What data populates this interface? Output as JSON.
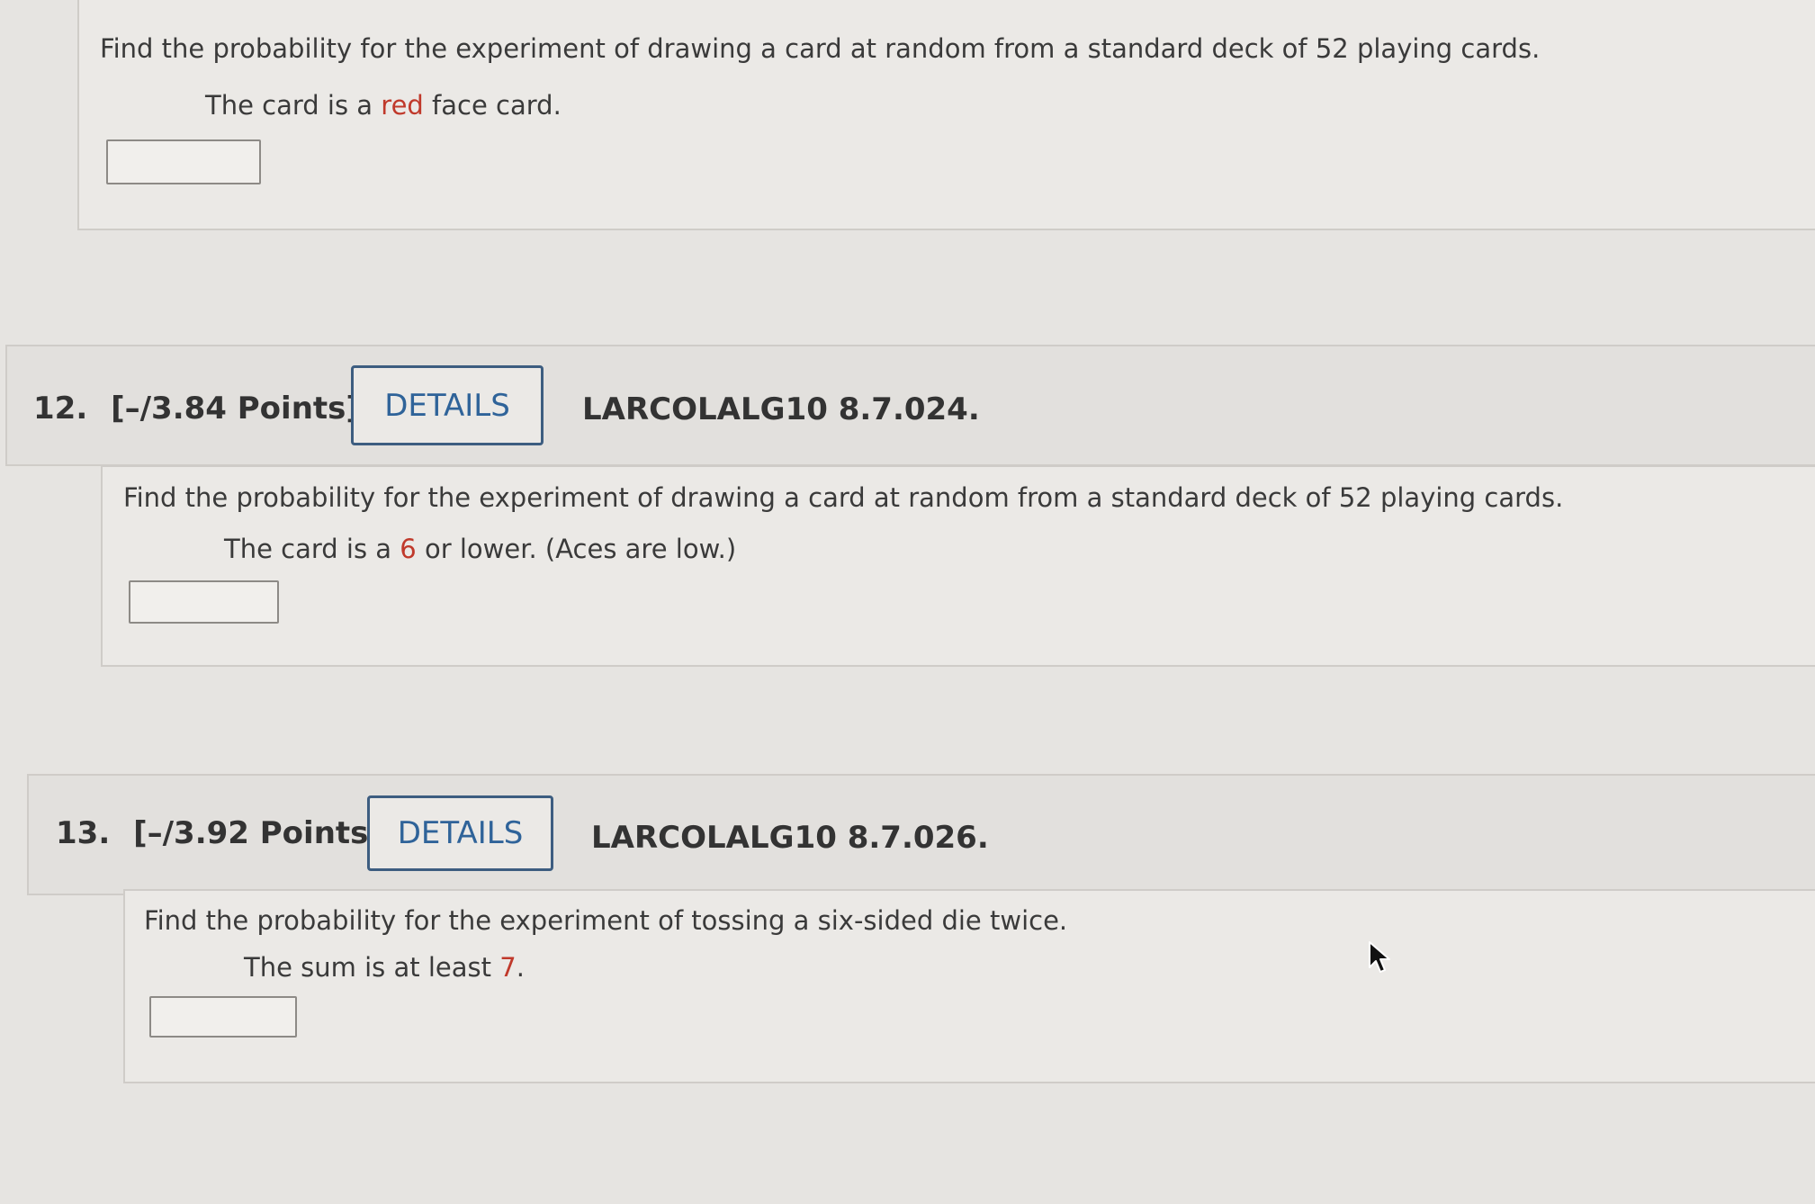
{
  "q11": {
    "prompt": "Find the probability for the experiment of drawing a card at random from a standard deck of 52 playing cards.",
    "condition_pre": "The card is a ",
    "condition_hl": "red",
    "condition_post": " face card."
  },
  "q12": {
    "number": "12.",
    "points": "[–/3.84 Points]",
    "details_label": "DETAILS",
    "code": "LARCOLALG10 8.7.024.",
    "prompt": "Find the probability for the experiment of drawing a card at random from a standard deck of 52 playing cards.",
    "condition_pre": "The card is a ",
    "condition_hl": "6",
    "condition_post": " or lower. (Aces are low.)"
  },
  "q13": {
    "number": "13.",
    "points": "[–/3.92 Points]",
    "details_label": "DETAILS",
    "code": "LARCOLALG10 8.7.026.",
    "prompt": "Find the probability for the experiment of tossing a six-sided die twice.",
    "condition_pre": "The sum is at least ",
    "condition_hl": "7",
    "condition_post": "."
  },
  "colors": {
    "highlight": "#c0392b",
    "details_text": "#2f6399",
    "background": "#e6e4e1"
  },
  "icons": {
    "cursor": "mouse-pointer-icon"
  }
}
